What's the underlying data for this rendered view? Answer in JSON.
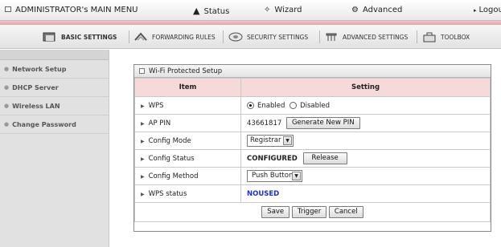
{
  "topbar": {
    "title": "ADMINISTRATOR's MAIN MENU",
    "status": "Status",
    "wizard": "Wizard",
    "advanced": "Advanced",
    "logout": "Logou"
  },
  "tabs": [
    {
      "label": "BASIC SETTINGS",
      "icon": "basic-settings-icon"
    },
    {
      "label": "FORWARDING RULES",
      "icon": "forwarding-rules-icon"
    },
    {
      "label": "SECURITY SETTINGS",
      "icon": "security-settings-icon"
    },
    {
      "label": "ADVANCED SETTINGS",
      "icon": "advanced-settings-icon"
    },
    {
      "label": "TOOLBOX",
      "icon": "toolbox-icon"
    }
  ],
  "sidebar": {
    "items": [
      {
        "label": "Network Setup"
      },
      {
        "label": "DHCP Server"
      },
      {
        "label": "Wireless LAN"
      },
      {
        "label": "Change Password"
      }
    ]
  },
  "panel": {
    "title": "Wi-Fi Protected Setup",
    "col_item": "Item",
    "col_setting": "Setting",
    "wps": {
      "label": "WPS",
      "enabled": "Enabled",
      "disabled": "Disabled",
      "selected": "Enabled"
    },
    "ap_pin": {
      "label": "AP PIN",
      "value": "43661817",
      "button": "Generate New PIN"
    },
    "config_mode": {
      "label": "Config Mode",
      "value": "Registrar"
    },
    "config_status": {
      "label": "Config Status",
      "value": "CONFIGURED",
      "button": "Release"
    },
    "config_method": {
      "label": "Config Method",
      "value": "Push Button"
    },
    "wps_status": {
      "label": "WPS status",
      "value": "NOUSED"
    },
    "buttons": {
      "save": "Save",
      "trigger": "Trigger",
      "cancel": "Cancel"
    }
  },
  "colors": {
    "header_bg": "#f6dada",
    "accent_line": "#e8a2a2",
    "status_blue": "#1a2fd8"
  }
}
